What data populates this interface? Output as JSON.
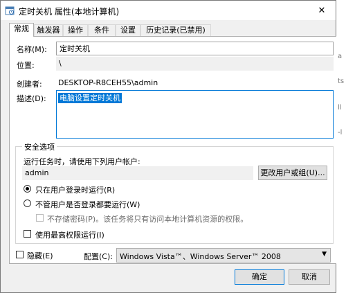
{
  "window": {
    "title": "定时关机 属性(本地计算机)",
    "close_glyph": "✕"
  },
  "tabs": [
    {
      "label": "常规",
      "active": true
    },
    {
      "label": "触发器",
      "active": false
    },
    {
      "label": "操作",
      "active": false
    },
    {
      "label": "条件",
      "active": false
    },
    {
      "label": "设置",
      "active": false
    },
    {
      "label": "历史记录(已禁用)",
      "active": false
    }
  ],
  "general": {
    "name_label": "名称(M):",
    "name_value": "定时关机",
    "location_label": "位置:",
    "location_value": "\\",
    "author_label": "创建者:",
    "author_value": "DESKTOP-R8CEH55\\admin",
    "description_label": "描述(D):",
    "description_value": "电脑设置定时关机"
  },
  "security": {
    "group_title": "安全选项",
    "run_as_label": "运行任务时，请使用下列用户帐户:",
    "user_account": "admin",
    "change_user_button": "更改用户或组(U)...",
    "radio_logged_on": "只在用户登录时运行(R)",
    "radio_logged_on_selected": true,
    "radio_whether_logged": "不管用户是否登录都要运行(W)",
    "radio_whether_logged_selected": false,
    "no_store_password": "不存储密码(P)。该任务将只有访问本地计算机资源的权限。",
    "highest_privileges": "使用最高权限运行(I)"
  },
  "footer": {
    "hidden_label": "隐藏(E)",
    "configure_label": "配置(C):",
    "configure_value": "Windows Vista™、Windows Server™ 2008",
    "ok_button": "确定",
    "cancel_button": "取消"
  },
  "background_window": {
    "fragment_lines": [
      "a",
      "ts",
      "ll",
      "-l"
    ]
  },
  "colors": {
    "accent": "#0078d7",
    "window_bg": "#f0f0f0",
    "panel_bg": "#ffffff"
  }
}
